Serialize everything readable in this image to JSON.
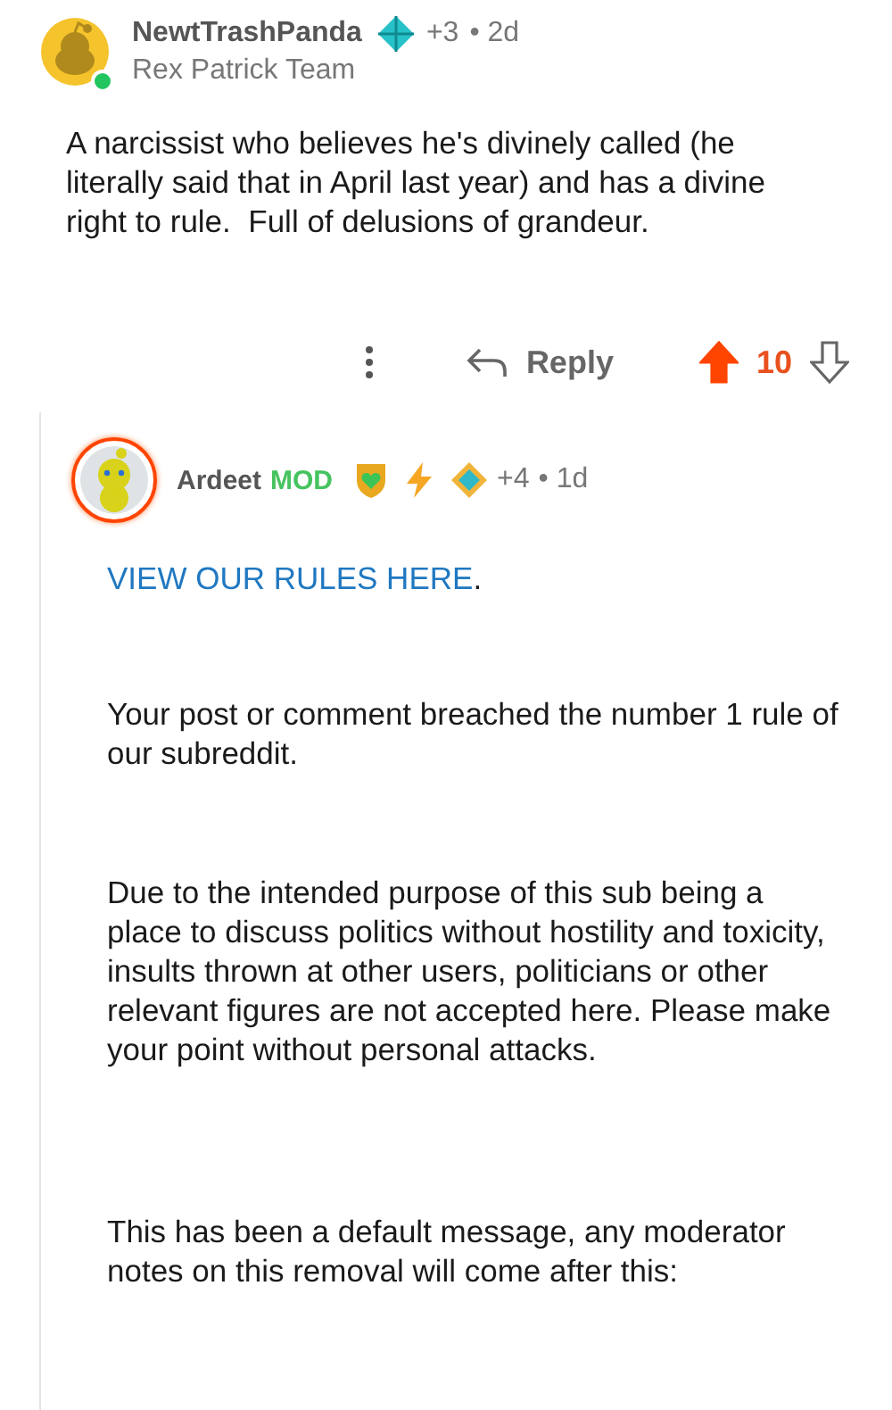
{
  "comment": {
    "author": "NewtTrashPanda",
    "award_count": "+3",
    "age": "• 2d",
    "flair": "Rex Patrick Team",
    "online": true,
    "paragraphs": [
      "A narcissist who believes he's divinely called (he literally said that in April last year) and has a divine right to rule.  Full of delusions of grandeur."
    ],
    "actions": {
      "reply": "Reply",
      "score": "10",
      "upvoted": true
    },
    "replies": [
      {
        "author": "Ardeet",
        "role": "MOD",
        "award_count": "+4",
        "age": "• 1d",
        "ringed": true,
        "paragraphs": [
          {
            "link": "VIEW OUR RULES HERE",
            "text": "."
          },
          {
            "text": "Your post or comment breached the number 1 rule of our subreddit."
          },
          {
            "text": "Due to the intended purpose of this sub being a place to discuss politics without hostility and toxicity, insults thrown at other users, politicians or other relevant figures are not accepted here. Please make your point without personal attacks."
          },
          {
            "text": "This has been a default message, any moderator notes on this removal will come after this:"
          }
        ]
      }
    ]
  }
}
